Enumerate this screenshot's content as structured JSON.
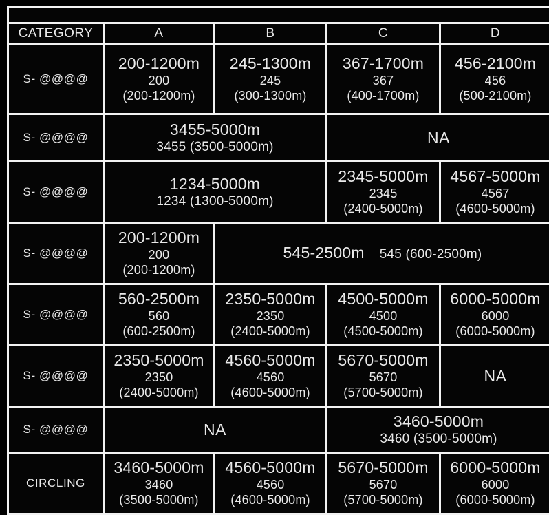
{
  "table": {
    "columns": [
      "CATEGORY",
      "A",
      "B",
      "C",
      "D"
    ],
    "na_label": "NA",
    "rows": [
      {
        "category": "S- @@@@",
        "cells": [
          {
            "span": 1,
            "big": "200-1200m",
            "mid": "200",
            "small": "(200-1200m)"
          },
          {
            "span": 1,
            "big": "245-1300m",
            "mid": "245",
            "small": "(300-1300m)"
          },
          {
            "span": 1,
            "big": "367-1700m",
            "mid": "367",
            "small": "(400-1700m)"
          },
          {
            "span": 1,
            "big": "456-2100m",
            "mid": "456",
            "small": "(500-2100m)"
          }
        ]
      },
      {
        "category": "S- @@@@",
        "cells": [
          {
            "span": 2,
            "big": "3455-5000m",
            "small": "3455 (3500-5000m)"
          },
          {
            "span": 2,
            "na": "NA"
          }
        ]
      },
      {
        "category": "S- @@@@",
        "cells": [
          {
            "span": 2,
            "big": "1234-5000m",
            "small": "1234 (1300-5000m)"
          },
          {
            "span": 1,
            "big": "2345-5000m",
            "mid": "2345",
            "small": "(2400-5000m)"
          },
          {
            "span": 1,
            "big": "4567-5000m",
            "mid": "4567",
            "small": "(4600-5000m)"
          }
        ]
      },
      {
        "category": "S- @@@@",
        "cells": [
          {
            "span": 1,
            "big": "200-1200m",
            "mid": "200",
            "small": "(200-1200m)"
          },
          {
            "span": 3,
            "inline": true,
            "big": "545-2500m",
            "small": "545 (600-2500m)"
          }
        ]
      },
      {
        "category": "S- @@@@",
        "cells": [
          {
            "span": 1,
            "big": "560-2500m",
            "mid": "560",
            "small": "(600-2500m)"
          },
          {
            "span": 1,
            "big": "2350-5000m",
            "mid": "2350",
            "small": "(2400-5000m)"
          },
          {
            "span": 1,
            "big": "4500-5000m",
            "mid": "4500",
            "small": "(4500-5000m)"
          },
          {
            "span": 1,
            "big": "6000-5000m",
            "mid": "6000",
            "small": "(6000-5000m)"
          }
        ]
      },
      {
        "category": "S- @@@@",
        "cells": [
          {
            "span": 1,
            "big": "2350-5000m",
            "mid": "2350",
            "small": "(2400-5000m)"
          },
          {
            "span": 1,
            "big": "4560-5000m",
            "mid": "4560",
            "small": "(4600-5000m)"
          },
          {
            "span": 1,
            "big": "5670-5000m",
            "mid": "5670",
            "small": "(5700-5000m)"
          },
          {
            "span": 1,
            "na": "NA"
          }
        ]
      },
      {
        "category": "S- @@@@",
        "cells": [
          {
            "span": 2,
            "na": "NA"
          },
          {
            "span": 2,
            "big": "3460-5000m",
            "small": "3460 (3500-5000m)"
          }
        ]
      },
      {
        "category": "CIRCLING",
        "cells": [
          {
            "span": 1,
            "big": "3460-5000m",
            "mid": "3460",
            "small": "(3500-5000m)"
          },
          {
            "span": 1,
            "big": "4560-5000m",
            "mid": "4560",
            "small": "(4600-5000m)"
          },
          {
            "span": 1,
            "big": "5670-5000m",
            "mid": "5670",
            "small": "(5700-5000m)"
          },
          {
            "span": 1,
            "big": "6000-5000m",
            "mid": "6000",
            "small": "(6000-5000m)"
          }
        ]
      }
    ]
  },
  "colors": {
    "background": "#000000",
    "grid": "#f2f2f2",
    "cell": "#050505",
    "text": "#e9e9e9"
  }
}
